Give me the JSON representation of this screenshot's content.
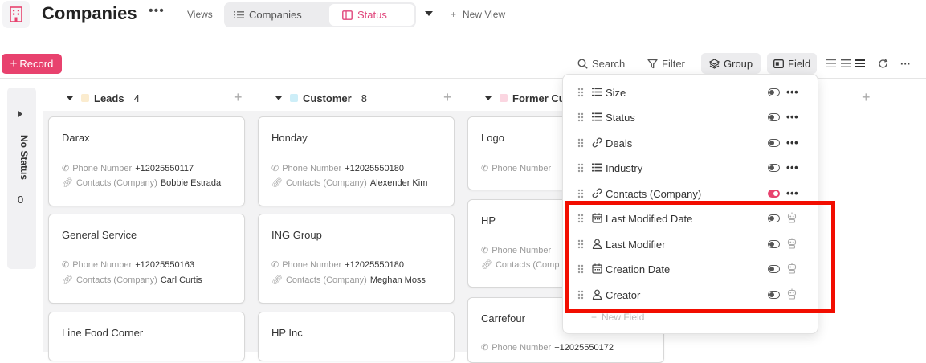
{
  "header": {
    "title": "Companies",
    "more": "•••",
    "views_label": "Views",
    "views": [
      {
        "label": "Companies",
        "icon": "list-icon",
        "active": false
      },
      {
        "label": "Status",
        "icon": "board-icon",
        "active": true
      }
    ],
    "new_view": "New View"
  },
  "toolbar": {
    "record": "Record",
    "search": "Search",
    "filter": "Filter",
    "group": "Group",
    "field": "Field",
    "more": "···"
  },
  "no_status": {
    "label": "No Status",
    "count": "0"
  },
  "groups": [
    {
      "name": "Leads",
      "count": "4",
      "color": "#fbeccf",
      "cards": [
        {
          "title": "Darax",
          "phone_label": "Phone Number",
          "phone": "+12025550117",
          "contacts_label": "Contacts (Company)",
          "contact": "Bobbie Estrada"
        },
        {
          "title": "General Service",
          "phone_label": "Phone Number",
          "phone": "+12025550163",
          "contacts_label": "Contacts (Company)",
          "contact": "Carl Curtis"
        },
        {
          "title": "Line Food Corner"
        }
      ]
    },
    {
      "name": "Customer",
      "count": "8",
      "color": "#cdeef8",
      "cards": [
        {
          "title": "Honday",
          "phone_label": "Phone Number",
          "phone": "+12025550180",
          "contacts_label": "Contacts (Company)",
          "contact": "Alexender Kim"
        },
        {
          "title": "ING Group",
          "phone_label": "Phone Number",
          "phone": "+12025550180",
          "contacts_label": "Contacts (Company)",
          "contact": "Meghan Moss"
        },
        {
          "title": "HP Inc"
        }
      ]
    },
    {
      "name": "Former Cus",
      "color": "#fbd6e1",
      "cards": [
        {
          "title": "Logo",
          "phone_label": "Phone Number"
        },
        {
          "title": "HP",
          "phone_label": "Phone Number",
          "contacts_label": "Contacts (Comp"
        },
        {
          "title": "Carrefour",
          "phone_label": "Phone Number",
          "phone": "+12025550172"
        }
      ]
    }
  ],
  "field_menu": {
    "items": [
      {
        "label": "Size",
        "icon": "list-icon",
        "visible": false,
        "action": "•••"
      },
      {
        "label": "Status",
        "icon": "list-icon",
        "visible": false,
        "action": "•••"
      },
      {
        "label": "Deals",
        "icon": "link-icon",
        "visible": false,
        "action": "•••"
      },
      {
        "label": "Industry",
        "icon": "list-icon",
        "visible": false,
        "action": "•••"
      },
      {
        "label": "Contacts (Company)",
        "icon": "link-icon",
        "visible": true,
        "action": "•••"
      },
      {
        "label": "Last Modified Date",
        "icon": "calendar-icon",
        "visible": false,
        "action": "robot-icon"
      },
      {
        "label": "Last Modifier",
        "icon": "user-icon",
        "visible": false,
        "action": "robot-icon"
      },
      {
        "label": "Creation Date",
        "icon": "calendar-icon",
        "visible": false,
        "action": "robot-icon"
      },
      {
        "label": "Creator",
        "icon": "user-icon",
        "visible": false,
        "action": "robot-icon"
      }
    ],
    "new_field": "New Field"
  },
  "colors": {
    "accent": "#e8426e",
    "highlight": "#f20d00"
  }
}
